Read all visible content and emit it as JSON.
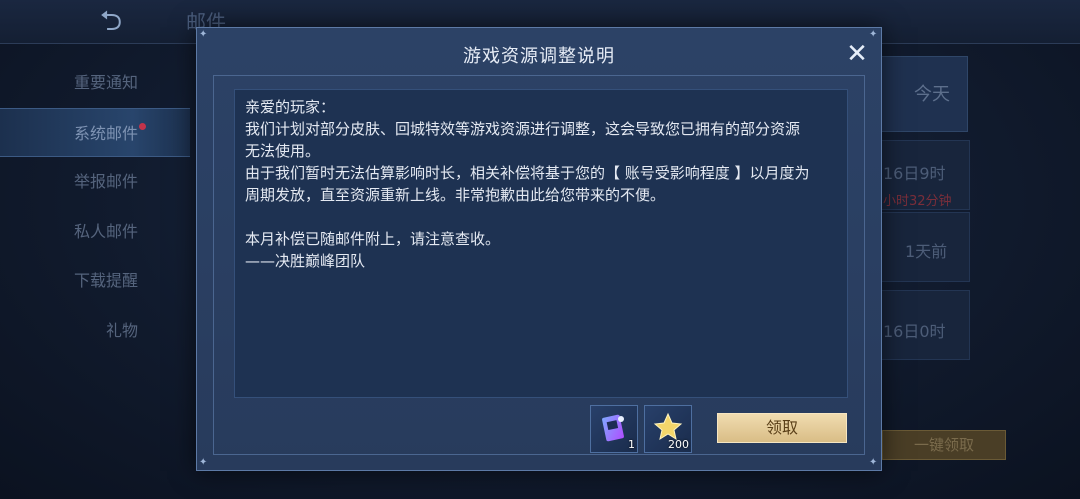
{
  "header": {
    "title": "邮件",
    "back_icon": "back-arrow-icon"
  },
  "sidebar": {
    "items": [
      {
        "label": "重要通知",
        "active": false
      },
      {
        "label": "系统邮件",
        "active": true,
        "has_badge": true
      },
      {
        "label": "举报邮件",
        "active": false
      },
      {
        "label": "私人邮件",
        "active": false
      },
      {
        "label": "下载提醒",
        "active": false
      },
      {
        "label": "礼物",
        "active": false
      }
    ]
  },
  "background_list": {
    "today_label": "今天",
    "row1_time": "16日9时",
    "row1_countdown": "小时32分钟",
    "row2_time": "1天前",
    "row3_time": "16日0时",
    "claim_all_label": "一键领取"
  },
  "modal": {
    "title": "游戏资源调整说明",
    "close_icon": "close-icon",
    "body_lines": [
      "亲爱的玩家：",
      "我们计划对部分皮肤、回城特效等游戏资源进行调整，这会导致您已拥有的部分资源",
      "无法使用。",
      "由于我们暂时无法估算影响时长，相关补偿将基于您的【 账号受影响程度 】以月度为",
      "周期发放，直至资源重新上线。非常抱歉由此给您带来的不便。",
      "",
      "本月补偿已随邮件附上，请注意查收。",
      "——决胜巅峰团队"
    ],
    "rewards": [
      {
        "icon": "skin-card-icon",
        "count": "1"
      },
      {
        "icon": "star-icon",
        "count": "200"
      }
    ],
    "claim_label": "领取"
  },
  "colors": {
    "modal_bg": "#2a3f62",
    "content_bg": "#1e3252",
    "claim_button": "#e6cd9a",
    "badge_red": "#c3334a"
  }
}
